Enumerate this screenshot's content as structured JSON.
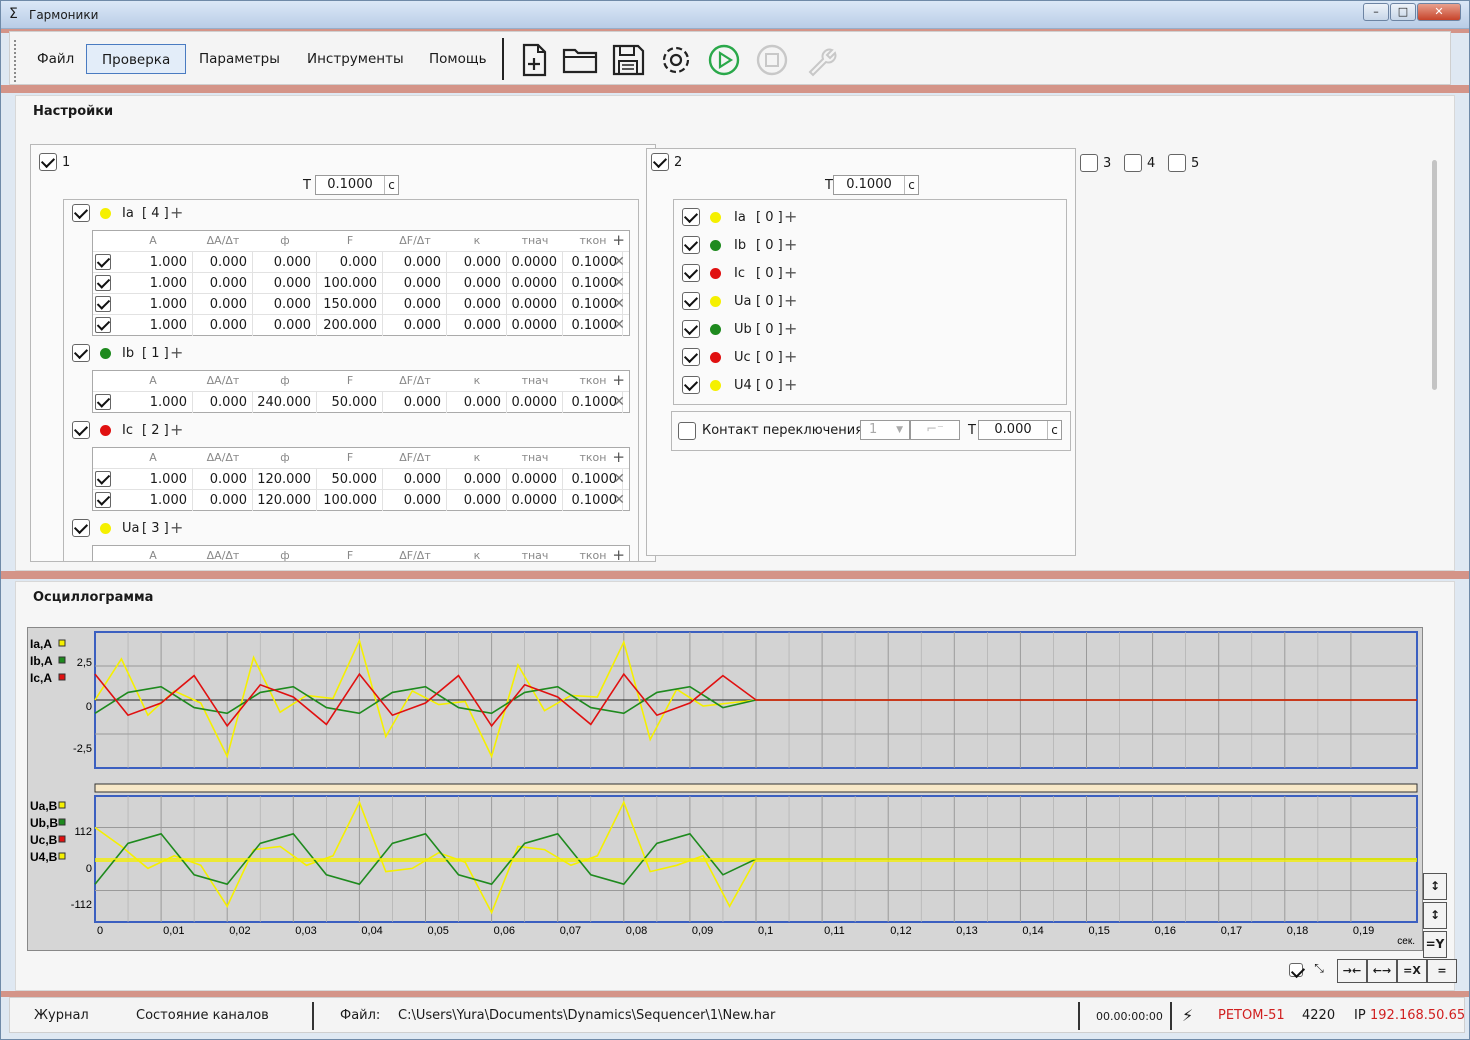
{
  "window": {
    "title": "Гармоники"
  },
  "menu": [
    "Файл",
    "Проверка",
    "Параметры",
    "Инструменты",
    "Помощь"
  ],
  "toolbar": {
    "icons": [
      "new-file-icon",
      "open-folder-icon",
      "save-icon",
      "settings-icon",
      "play-icon",
      "stop-icon",
      "wrench-icon"
    ],
    "accent": "#2aa84a"
  },
  "settings": {
    "title": "Настройки",
    "group1": {
      "label": "1",
      "t_label": "T",
      "t_value": "0.1000",
      "unit": "с",
      "columns": [
        "A",
        "ΔA/Δт",
        "ф",
        "F",
        "ΔF/Δт",
        "к",
        "тнач",
        "ткон"
      ],
      "channels": [
        {
          "name": "Ia",
          "count": "[ 4 ]",
          "color": "#f5f000",
          "rows": [
            [
              "1.000",
              "0.000",
              "0.000",
              "0.000",
              "0.000",
              "0.000",
              "0.0000",
              "0.1000"
            ],
            [
              "1.000",
              "0.000",
              "0.000",
              "100.000",
              "0.000",
              "0.000",
              "0.0000",
              "0.1000"
            ],
            [
              "1.000",
              "0.000",
              "0.000",
              "150.000",
              "0.000",
              "0.000",
              "0.0000",
              "0.1000"
            ],
            [
              "1.000",
              "0.000",
              "0.000",
              "200.000",
              "0.000",
              "0.000",
              "0.0000",
              "0.1000"
            ]
          ]
        },
        {
          "name": "Ib",
          "count": "[ 1 ]",
          "color": "#1e8a1e",
          "rows": [
            [
              "1.000",
              "0.000",
              "240.000",
              "50.000",
              "0.000",
              "0.000",
              "0.0000",
              "0.1000"
            ]
          ]
        },
        {
          "name": "Ic",
          "count": "[ 2 ]",
          "color": "#e01010",
          "rows": [
            [
              "1.000",
              "0.000",
              "120.000",
              "50.000",
              "0.000",
              "0.000",
              "0.0000",
              "0.1000"
            ],
            [
              "1.000",
              "0.000",
              "120.000",
              "100.000",
              "0.000",
              "0.000",
              "0.0000",
              "0.1000"
            ]
          ]
        },
        {
          "name": "Ua",
          "count": "[ 3 ]",
          "color": "#f5f000",
          "rows": []
        }
      ]
    },
    "group2": {
      "label": "2",
      "t_label": "T",
      "t_value": "0.1000",
      "unit": "с",
      "channels": [
        {
          "name": "Ia",
          "count": "[ 0 ]",
          "color": "#f5f000"
        },
        {
          "name": "Ib",
          "count": "[ 0 ]",
          "color": "#1e8a1e"
        },
        {
          "name": "Ic",
          "count": "[ 0 ]",
          "color": "#e01010"
        },
        {
          "name": "Ua",
          "count": "[ 0 ]",
          "color": "#f5f000"
        },
        {
          "name": "Ub",
          "count": "[ 0 ]",
          "color": "#1e8a1e"
        },
        {
          "name": "Uc",
          "count": "[ 0 ]",
          "color": "#e01010"
        },
        {
          "name": "U4",
          "count": "[ 0 ]",
          "color": "#f5f000"
        }
      ],
      "contact": {
        "label": "Контакт переключения",
        "select": "1",
        "t_label": "T",
        "t_value": "0.000",
        "unit": "с"
      }
    },
    "other_groups": [
      "3",
      "4",
      "5"
    ]
  },
  "oscillogram": {
    "title": "Осциллограмма",
    "current_legend": [
      {
        "name": "Ia,A",
        "color": "#f5f000"
      },
      {
        "name": "Ib,A",
        "color": "#1e8a1e"
      },
      {
        "name": "Ic,A",
        "color": "#e01010"
      }
    ],
    "voltage_legend": [
      {
        "name": "Ua,B",
        "color": "#f5f000"
      },
      {
        "name": "Ub,B",
        "color": "#1e8a1e"
      },
      {
        "name": "Uc,B",
        "color": "#e01010"
      },
      {
        "name": "U4,B",
        "color": "#f5f000"
      }
    ],
    "current_ticks": [
      "2,5",
      "0",
      "-2,5"
    ],
    "voltage_ticks": [
      "112",
      "0",
      "-112"
    ],
    "x_ticks": [
      "0",
      "0,01",
      "0,02",
      "0,03",
      "0,04",
      "0,05",
      "0,06",
      "0,07",
      "0,08",
      "0,09",
      "0,1",
      "0,11",
      "0,12",
      "0,13",
      "0,14",
      "0,15",
      "0,16",
      "0,17",
      "0,18",
      "0,19"
    ],
    "x_unit": "сек.",
    "side_buttons": [
      "↕",
      "↕",
      "=Y"
    ],
    "bottom_buttons": [
      "→←",
      "←→",
      "=X",
      "="
    ]
  },
  "chart_data": [
    {
      "type": "line",
      "title": "",
      "xlabel": "сек.",
      "ylabel": "",
      "xlim": [
        0,
        0.2
      ],
      "ylim": [
        -2.5,
        2.5
      ],
      "series": [
        {
          "name": "Ia,A",
          "color": "#f5f000",
          "x": [
            0,
            0.004,
            0.008,
            0.012,
            0.016,
            0.02,
            0.024,
            0.028,
            0.032,
            0.036,
            0.04,
            0.044,
            0.048,
            0.052,
            0.056,
            0.06,
            0.064,
            0.068,
            0.072,
            0.076,
            0.08,
            0.084,
            0.088,
            0.092,
            0.096,
            0.1,
            0.2
          ],
          "y": [
            0,
            2.7,
            -1.0,
            0.6,
            -0.2,
            -3.7,
            2.8,
            -0.8,
            0.3,
            0.1,
            3.9,
            -2.4,
            0.6,
            -0.3,
            -0.1,
            -3.7,
            2.3,
            -0.7,
            0.3,
            0.2,
            3.8,
            -2.6,
            0.7,
            -0.4,
            -0.2,
            0,
            0
          ]
        },
        {
          "name": "Ib,A",
          "color": "#1e8a1e",
          "x": [
            0,
            0.005,
            0.01,
            0.015,
            0.02,
            0.025,
            0.03,
            0.035,
            0.04,
            0.045,
            0.05,
            0.055,
            0.06,
            0.065,
            0.07,
            0.075,
            0.08,
            0.085,
            0.09,
            0.095,
            0.1,
            0.2
          ],
          "y": [
            -0.87,
            0.5,
            0.87,
            -0.5,
            -0.87,
            0.5,
            0.87,
            -0.5,
            -0.87,
            0.5,
            0.87,
            -0.5,
            -0.87,
            0.5,
            0.87,
            -0.5,
            -0.87,
            0.5,
            0.87,
            -0.5,
            0,
            0
          ]
        },
        {
          "name": "Ic,A",
          "color": "#e01010",
          "x": [
            0,
            0.005,
            0.01,
            0.015,
            0.02,
            0.025,
            0.03,
            0.035,
            0.04,
            0.045,
            0.05,
            0.055,
            0.06,
            0.065,
            0.07,
            0.075,
            0.08,
            0.085,
            0.09,
            0.095,
            0.1,
            0.2
          ],
          "y": [
            1.7,
            -1.0,
            -0.2,
            1.6,
            -1.7,
            1.0,
            0.2,
            -1.6,
            1.7,
            -1.0,
            -0.2,
            1.6,
            -1.7,
            1.0,
            0.2,
            -1.6,
            1.7,
            -1.0,
            -0.2,
            1.6,
            0,
            0
          ]
        }
      ]
    },
    {
      "type": "line",
      "title": "",
      "xlabel": "сек.",
      "ylabel": "",
      "xlim": [
        0,
        0.2
      ],
      "ylim": [
        -112,
        112
      ],
      "series": [
        {
          "name": "Ua,B",
          "color": "#f5f000",
          "x": [
            0,
            0.004,
            0.008,
            0.012,
            0.016,
            0.02,
            0.024,
            0.028,
            0.032,
            0.036,
            0.04,
            0.044,
            0.048,
            0.052,
            0.056,
            0.06,
            0.064,
            0.068,
            0.072,
            0.076,
            0.08,
            0.084,
            0.088,
            0.092,
            0.096,
            0.1,
            0.2
          ],
          "y": [
            100,
            40,
            -30,
            10,
            -20,
            -150,
            30,
            40,
            -20,
            10,
            180,
            -40,
            -30,
            20,
            -10,
            -170,
            40,
            30,
            -20,
            10,
            180,
            -40,
            -20,
            10,
            -150,
            0,
            0
          ]
        },
        {
          "name": "Ub,B",
          "color": "#1e8a1e",
          "x": [
            0,
            0.005,
            0.01,
            0.015,
            0.02,
            0.025,
            0.03,
            0.035,
            0.04,
            0.045,
            0.05,
            0.055,
            0.06,
            0.065,
            0.07,
            0.075,
            0.08,
            0.085,
            0.09,
            0.095,
            0.1,
            0.2
          ],
          "y": [
            -80,
            50,
            80,
            -50,
            -80,
            50,
            80,
            -50,
            -80,
            50,
            80,
            -50,
            -80,
            50,
            80,
            -50,
            -80,
            50,
            80,
            -50,
            0,
            0
          ]
        },
        {
          "name": "U4,B",
          "color": "#f5f000",
          "x": [
            0,
            0.2
          ],
          "y": [
            0,
            0
          ]
        }
      ]
    }
  ]
}
